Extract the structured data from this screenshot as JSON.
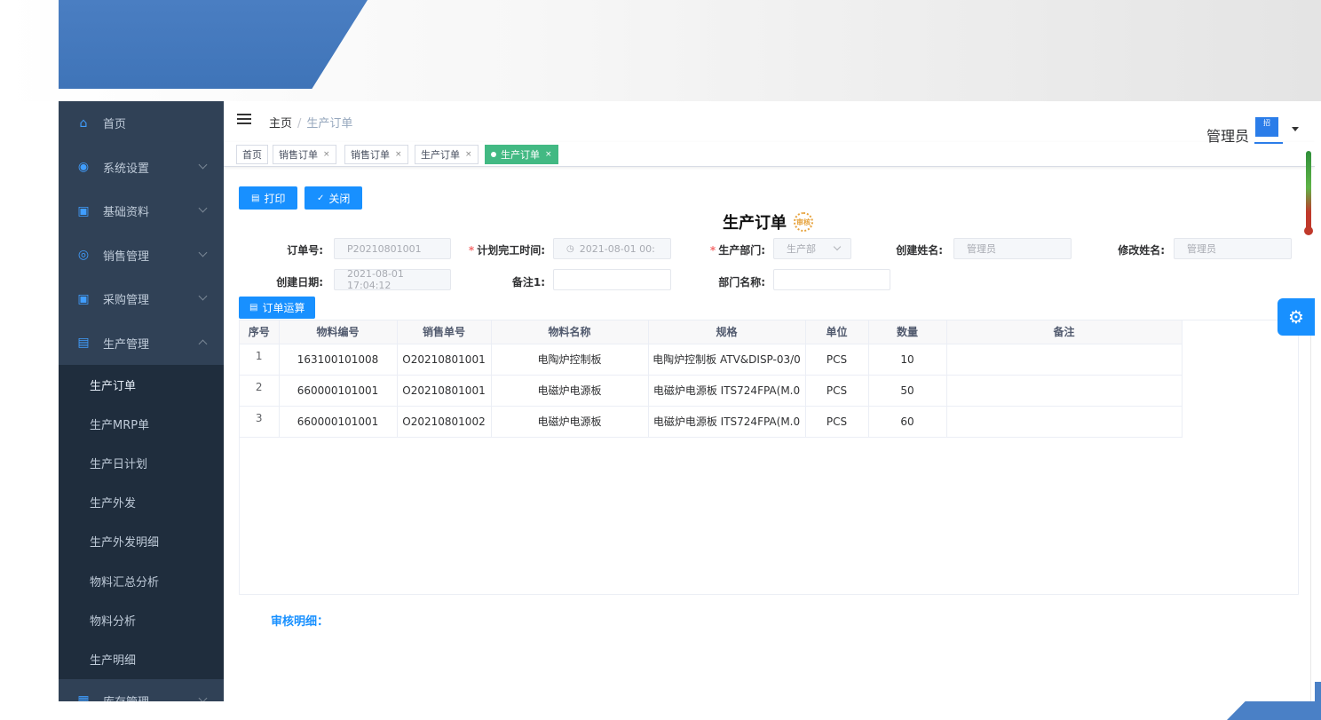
{
  "sidebar": {
    "items": [
      {
        "label": "首页",
        "icon": "home-icon",
        "glyph": "⌂"
      },
      {
        "label": "系统设置",
        "icon": "settings-circle-icon",
        "glyph": "◉"
      },
      {
        "label": "基础资料",
        "icon": "car-icon",
        "glyph": "▣"
      },
      {
        "label": "销售管理",
        "icon": "coins-icon",
        "glyph": "◎"
      },
      {
        "label": "采购管理",
        "icon": "truck-icon",
        "glyph": "▣"
      },
      {
        "label": "生产管理",
        "icon": "factory-icon",
        "glyph": "▤"
      },
      {
        "label": "库存管理",
        "icon": "warehouse-icon",
        "glyph": "▦"
      }
    ],
    "submenu": [
      "生产订单",
      "生产MRP单",
      "生产日计划",
      "生产外发",
      "生产外发明细",
      "物料汇总分析",
      "物料分析",
      "生产明细"
    ]
  },
  "navbar": {
    "breadcrumb_home": "主页",
    "breadcrumb_sep": "/",
    "breadcrumb_current": "生产订单",
    "username": "管理员",
    "avatar_text": "招"
  },
  "tags": [
    {
      "label": "首页"
    },
    {
      "label": "销售订单",
      "close": "×"
    },
    {
      "label": "销售订单",
      "close": "×"
    },
    {
      "label": "生产订单",
      "close": "×"
    },
    {
      "label": "生产订单",
      "close": "×"
    }
  ],
  "toolbar": {
    "print_label": "打印",
    "close_label": "关闭",
    "calc_label": "订单运算"
  },
  "page_title": "生产订单",
  "stamp_text": "审核",
  "form": {
    "order_no_label": "订单号:",
    "order_no_value": "P20210801001",
    "plan_time_label": "计划完工时间:",
    "plan_time_value": "2021-08-01 00:",
    "dept_label": "生产部门:",
    "dept_value": "生产部",
    "creator_label": "创建姓名:",
    "creator_value": "管理员",
    "modifier_label": "修改姓名:",
    "modifier_value": "管理员",
    "created_label": "创建日期:",
    "created_value": "2021-08-01 17:04:12",
    "remark1_label": "备注1:",
    "remark1_value": "",
    "dept_name_label": "部门名称:",
    "dept_name_value": "",
    "required_mark": "*"
  },
  "table": {
    "headers": [
      "序号",
      "物料编号",
      "销售单号",
      "物料名称",
      "规格",
      "单位",
      "数量",
      "备注"
    ],
    "rows": [
      [
        "1",
        "163100101008",
        "O20210801001",
        "电陶炉控制板",
        "电陶炉控制板 ATV&DISP-03/0",
        "PCS",
        "10",
        ""
      ],
      [
        "2",
        "660000101001",
        "O20210801001",
        "电磁炉电源板",
        "电磁炉电源板 ITS724FPA(M.0",
        "PCS",
        "50",
        ""
      ],
      [
        "3",
        "660000101001",
        "O20210801002",
        "电磁炉电源板",
        "电磁炉电源板 ITS724FPA(M.0",
        "PCS",
        "60",
        ""
      ]
    ]
  },
  "audit_label": "审核明细：",
  "colors": {
    "sidebar": "#304156",
    "submenu": "#1f2d3d",
    "primary": "#1890ff",
    "active_tag": "#42b983"
  }
}
